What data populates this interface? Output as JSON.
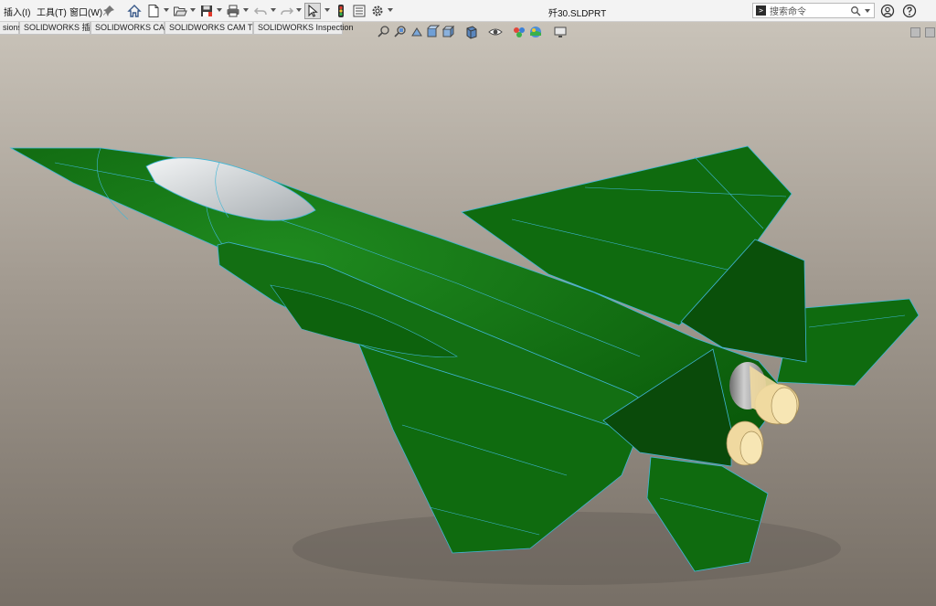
{
  "menu": {
    "insert": "插入(I)",
    "tools": "工具(T)",
    "window": "窗口(W)"
  },
  "document_title": "歼30.SLDPRT",
  "search": {
    "value": "搜索命令",
    "prompt_symbol": ">"
  },
  "tabs": [
    {
      "label": "sions"
    },
    {
      "label": "SOLIDWORKS 插件"
    },
    {
      "label": "SOLIDWORKS CAM"
    },
    {
      "label": "SOLIDWORKS CAM TBM"
    },
    {
      "label": "SOLIDWORKS Inspection"
    }
  ],
  "colors": {
    "model_green": "#0f6b0f",
    "model_green_dark": "#094a09",
    "edge_cyan": "#3fb6d6",
    "canopy": "#cfd3d6",
    "nozzle": "#f0d9a0"
  },
  "icons": {
    "toolbar": [
      "pin-icon",
      "home-icon",
      "new-document-icon",
      "open-folder-icon",
      "save-icon",
      "print-icon",
      "undo-icon",
      "redo-icon",
      "select-arrow-icon",
      "traffic-light-icon",
      "options-list-icon",
      "gear-icon"
    ],
    "hud": [
      "zoom-to-fit-icon",
      "zoom-area-icon",
      "previous-view-icon",
      "section-view-icon",
      "view-orientation-icon",
      "display-style-icon",
      "hide-show-icon",
      "appearance-icon",
      "scene-icon",
      "display-settings-icon"
    ],
    "right": [
      "user-icon",
      "help-icon"
    ]
  }
}
